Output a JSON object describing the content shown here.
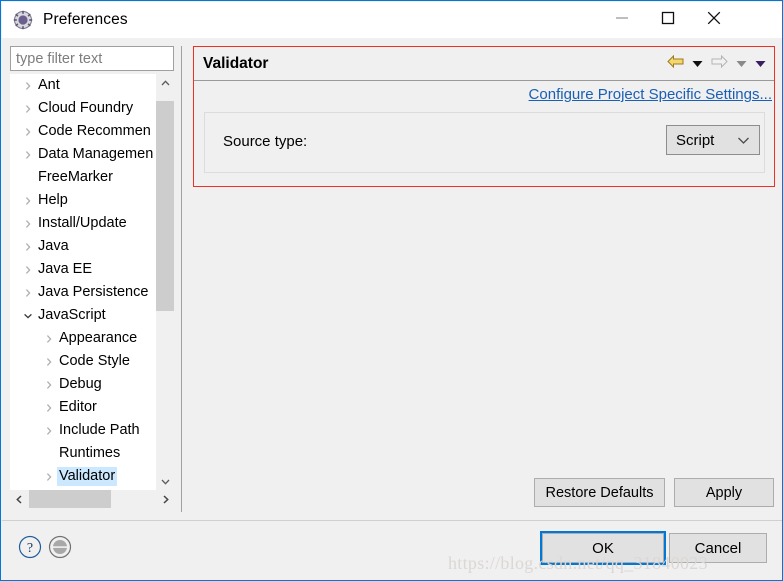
{
  "window": {
    "title": "Preferences",
    "icon": "gear-icon",
    "controls": {
      "minimize": "minimize-icon",
      "maximize": "maximize-icon",
      "close": "close-icon"
    }
  },
  "filter": {
    "placeholder": "type filter text",
    "value": ""
  },
  "tree": {
    "items": [
      {
        "label": "Ant",
        "level": 1,
        "twisty": "collapsed",
        "selected": false
      },
      {
        "label": "Cloud Foundry",
        "level": 1,
        "twisty": "collapsed",
        "selected": false
      },
      {
        "label": "Code Recommen",
        "level": 1,
        "twisty": "collapsed",
        "selected": false
      },
      {
        "label": "Data Managemen",
        "level": 1,
        "twisty": "collapsed",
        "selected": false
      },
      {
        "label": "FreeMarker",
        "level": 1,
        "twisty": "none",
        "selected": false
      },
      {
        "label": "Help",
        "level": 1,
        "twisty": "collapsed",
        "selected": false
      },
      {
        "label": "Install/Update",
        "level": 1,
        "twisty": "collapsed",
        "selected": false
      },
      {
        "label": "Java",
        "level": 1,
        "twisty": "collapsed",
        "selected": false
      },
      {
        "label": "Java EE",
        "level": 1,
        "twisty": "collapsed",
        "selected": false
      },
      {
        "label": "Java Persistence",
        "level": 1,
        "twisty": "collapsed",
        "selected": false
      },
      {
        "label": "JavaScript",
        "level": 1,
        "twisty": "expanded",
        "selected": false
      },
      {
        "label": "Appearance",
        "level": 2,
        "twisty": "collapsed",
        "selected": false
      },
      {
        "label": "Code Style",
        "level": 2,
        "twisty": "collapsed",
        "selected": false
      },
      {
        "label": "Debug",
        "level": 2,
        "twisty": "collapsed",
        "selected": false
      },
      {
        "label": "Editor",
        "level": 2,
        "twisty": "collapsed",
        "selected": false
      },
      {
        "label": "Include Path",
        "level": 2,
        "twisty": "collapsed",
        "selected": false
      },
      {
        "label": "Runtimes",
        "level": 2,
        "twisty": "none",
        "selected": false
      },
      {
        "label": "Validator",
        "level": 2,
        "twisty": "collapsed",
        "selected": true
      }
    ]
  },
  "page": {
    "title": "Validator",
    "configure_link": "Configure Project Specific Settings...",
    "source_type_label": "Source type:",
    "source_type_value": "Script",
    "source_type_options": [
      "Script"
    ],
    "nav": {
      "back": "back-arrow-icon",
      "back_menu": "dropdown-arrow-icon",
      "forward": "forward-arrow-icon",
      "forward_menu": "dropdown-arrow-icon",
      "view_menu": "dropdown-arrow-icon"
    },
    "restore_defaults_label": "Restore Defaults",
    "apply_label": "Apply"
  },
  "footer": {
    "help_label": "?",
    "help_icon": "question-mark-icon",
    "shell_icon": "shell-circle-icon",
    "ok_label": "OK",
    "cancel_label": "Cancel"
  },
  "watermark": {
    "text": "https://blog.csdn.net/qq_31840023"
  },
  "colors": {
    "window_border": "#0078d7",
    "highlight_box": "#ee3124",
    "selection": "#cce8ff",
    "link": "#1a5fb4",
    "focus": "#0078d7"
  }
}
